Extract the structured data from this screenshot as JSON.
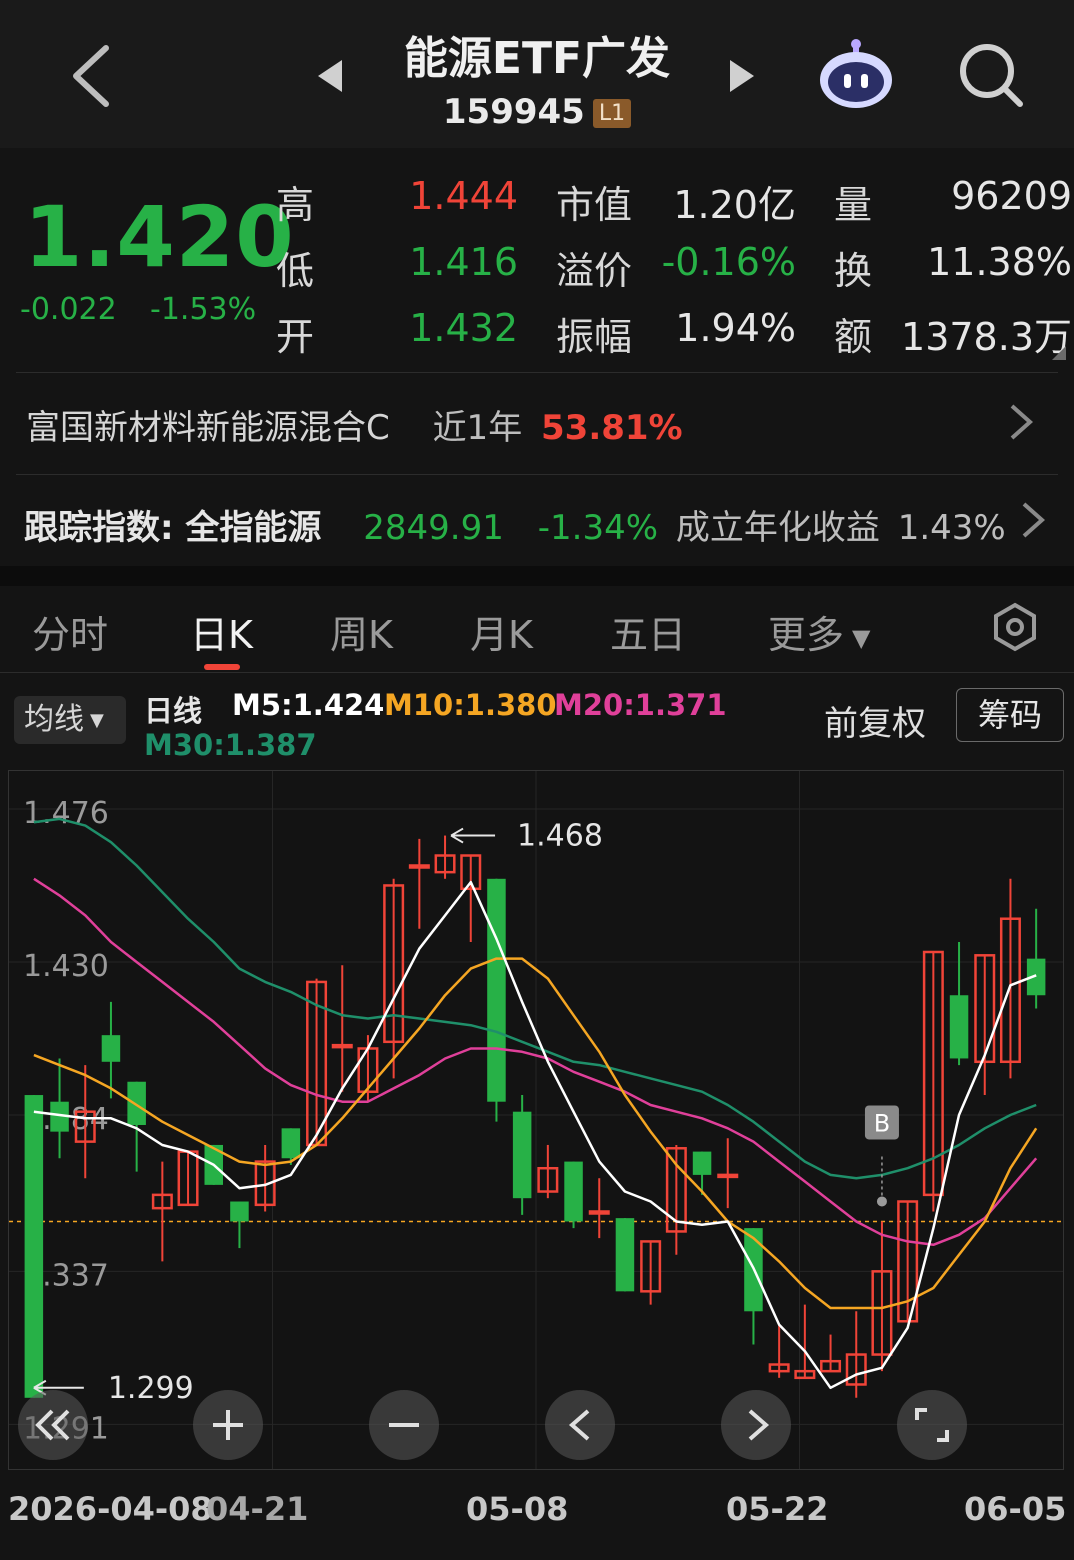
{
  "header": {
    "title": "能源ETF广发",
    "code": "159945",
    "level_badge": "L1"
  },
  "quote": {
    "price": "1.420",
    "change": "-0.022",
    "change_pct": "-1.53%",
    "labels": {
      "high": "高",
      "low": "低",
      "open": "开",
      "mktcap": "市值",
      "premium": "溢价",
      "amplitude": "振幅",
      "volume": "量",
      "turnover": "换",
      "amount": "额"
    },
    "high": "1.444",
    "low": "1.416",
    "open": "1.432",
    "mktcap": "1.20亿",
    "premium": "-0.16%",
    "amplitude": "1.94%",
    "volume": "96209",
    "turnover": "11.38%",
    "amount": "1378.3万"
  },
  "fund_row": {
    "name": "富国新材料新能源混合C",
    "period": "近1年",
    "return": "53.81%"
  },
  "index_row": {
    "label": "跟踪指数: 全指能源",
    "value": "2849.91",
    "change": "-1.34%",
    "since_label": "成立年化收益",
    "since_value": "1.43%"
  },
  "tabs": [
    "分时",
    "日K",
    "周K",
    "月K",
    "五日",
    "更多"
  ],
  "active_tab": "日K",
  "ma_toolbar": {
    "ma_button": "均线",
    "period": "日线",
    "m5": "M5:1.424",
    "m10": "M10:1.380",
    "m20": "M20:1.371",
    "m30": "M30:1.387",
    "adjust": "前复权",
    "chip": "筹码"
  },
  "colors": {
    "up": "#f04438",
    "down": "#27b147",
    "m5": "#ffffff",
    "m10": "#f5a623",
    "m20": "#e0409a",
    "m30": "#1f8f6a",
    "bg": "#141414"
  },
  "chart_data": {
    "type": "candlestick",
    "y_ticks": [
      "1.476",
      "1.430",
      "1.384",
      "1.337",
      "1.291"
    ],
    "ylim": [
      1.28,
      1.485
    ],
    "x_tick_labels": [
      "2026-04-08",
      "04-21",
      "05-08",
      "05-22",
      "06-05"
    ],
    "max_annotation": "1.468",
    "min_annotation": "1.299",
    "signal_marker": "B",
    "ref_price": 1.352,
    "candles": [
      {
        "o": 1.39,
        "h": 1.39,
        "l": 1.299,
        "c": 1.299
      },
      {
        "o": 1.388,
        "h": 1.401,
        "l": 1.371,
        "c": 1.379
      },
      {
        "o": 1.376,
        "h": 1.399,
        "l": 1.365,
        "c": 1.385
      },
      {
        "o": 1.408,
        "h": 1.418,
        "l": 1.389,
        "c": 1.4
      },
      {
        "o": 1.394,
        "h": 1.394,
        "l": 1.367,
        "c": 1.381
      },
      {
        "o": 1.356,
        "h": 1.37,
        "l": 1.34,
        "c": 1.36
      },
      {
        "o": 1.357,
        "h": 1.373,
        "l": 1.357,
        "c": 1.373
      },
      {
        "o": 1.375,
        "h": 1.375,
        "l": 1.363,
        "c": 1.363
      },
      {
        "o": 1.358,
        "h": 1.358,
        "l": 1.344,
        "c": 1.352
      },
      {
        "o": 1.357,
        "h": 1.375,
        "l": 1.355,
        "c": 1.37
      },
      {
        "o": 1.38,
        "h": 1.38,
        "l": 1.369,
        "c": 1.371
      },
      {
        "o": 1.375,
        "h": 1.425,
        "l": 1.375,
        "c": 1.424
      },
      {
        "o": 1.405,
        "h": 1.429,
        "l": 1.391,
        "c": 1.405
      },
      {
        "o": 1.391,
        "h": 1.408,
        "l": 1.388,
        "c": 1.404
      },
      {
        "o": 1.406,
        "h": 1.455,
        "l": 1.395,
        "c": 1.453
      },
      {
        "o": 1.459,
        "h": 1.467,
        "l": 1.44,
        "c": 1.459
      },
      {
        "o": 1.457,
        "h": 1.468,
        "l": 1.455,
        "c": 1.462
      },
      {
        "o": 1.452,
        "h": 1.462,
        "l": 1.436,
        "c": 1.462
      },
      {
        "o": 1.455,
        "h": 1.455,
        "l": 1.382,
        "c": 1.388
      },
      {
        "o": 1.385,
        "h": 1.39,
        "l": 1.354,
        "c": 1.359
      },
      {
        "o": 1.361,
        "h": 1.375,
        "l": 1.359,
        "c": 1.368
      },
      {
        "o": 1.37,
        "h": 1.37,
        "l": 1.35,
        "c": 1.352
      },
      {
        "o": 1.355,
        "h": 1.365,
        "l": 1.347,
        "c": 1.355
      },
      {
        "o": 1.353,
        "h": 1.353,
        "l": 1.331,
        "c": 1.331
      },
      {
        "o": 1.331,
        "h": 1.346,
        "l": 1.327,
        "c": 1.346
      },
      {
        "o": 1.349,
        "h": 1.375,
        "l": 1.342,
        "c": 1.374
      },
      {
        "o": 1.373,
        "h": 1.373,
        "l": 1.36,
        "c": 1.366
      },
      {
        "o": 1.366,
        "h": 1.377,
        "l": 1.356,
        "c": 1.366
      },
      {
        "o": 1.35,
        "h": 1.35,
        "l": 1.315,
        "c": 1.325
      },
      {
        "o": 1.307,
        "h": 1.321,
        "l": 1.305,
        "c": 1.309
      },
      {
        "o": 1.305,
        "h": 1.327,
        "l": 1.305,
        "c": 1.307
      },
      {
        "o": 1.307,
        "h": 1.318,
        "l": 1.307,
        "c": 1.31
      },
      {
        "o": 1.303,
        "h": 1.325,
        "l": 1.299,
        "c": 1.312
      },
      {
        "o": 1.312,
        "h": 1.352,
        "l": 1.307,
        "c": 1.337
      },
      {
        "o": 1.322,
        "h": 1.358,
        "l": 1.322,
        "c": 1.358
      },
      {
        "o": 1.36,
        "h": 1.433,
        "l": 1.355,
        "c": 1.433
      },
      {
        "o": 1.42,
        "h": 1.436,
        "l": 1.399,
        "c": 1.401
      },
      {
        "o": 1.4,
        "h": 1.432,
        "l": 1.39,
        "c": 1.432
      },
      {
        "o": 1.4,
        "h": 1.455,
        "l": 1.395,
        "c": 1.443
      },
      {
        "o": 1.431,
        "h": 1.446,
        "l": 1.416,
        "c": 1.42
      }
    ],
    "m5": [
      1.385,
      1.384,
      1.383,
      1.383,
      1.38,
      1.375,
      1.373,
      1.369,
      1.362,
      1.363,
      1.366,
      1.378,
      1.392,
      1.404,
      1.419,
      1.434,
      1.444,
      1.454,
      1.437,
      1.418,
      1.4,
      1.385,
      1.37,
      1.361,
      1.358,
      1.352,
      1.351,
      1.352,
      1.338,
      1.321,
      1.313,
      1.302,
      1.306,
      1.308,
      1.32,
      1.35,
      1.384,
      1.402,
      1.423,
      1.426
    ],
    "m10": [
      1.402,
      1.399,
      1.396,
      1.392,
      1.387,
      1.382,
      1.378,
      1.374,
      1.37,
      1.369,
      1.37,
      1.375,
      1.383,
      1.392,
      1.401,
      1.41,
      1.42,
      1.428,
      1.431,
      1.431,
      1.425,
      1.414,
      1.403,
      1.39,
      1.379,
      1.369,
      1.361,
      1.352,
      1.347,
      1.34,
      1.332,
      1.326,
      1.326,
      1.326,
      1.328,
      1.332,
      1.342,
      1.352,
      1.368,
      1.38
    ],
    "m20": [
      1.455,
      1.45,
      1.444,
      1.436,
      1.43,
      1.424,
      1.418,
      1.412,
      1.405,
      1.398,
      1.393,
      1.39,
      1.388,
      1.388,
      1.392,
      1.396,
      1.401,
      1.404,
      1.404,
      1.403,
      1.401,
      1.397,
      1.394,
      1.391,
      1.387,
      1.385,
      1.383,
      1.38,
      1.376,
      1.37,
      1.364,
      1.358,
      1.352,
      1.348,
      1.346,
      1.345,
      1.348,
      1.353,
      1.362,
      1.371
    ],
    "m30": [
      1.472,
      1.473,
      1.471,
      1.466,
      1.459,
      1.451,
      1.443,
      1.436,
      1.428,
      1.424,
      1.421,
      1.417,
      1.414,
      1.413,
      1.414,
      1.413,
      1.412,
      1.411,
      1.409,
      1.406,
      1.403,
      1.4,
      1.399,
      1.397,
      1.395,
      1.393,
      1.391,
      1.387,
      1.382,
      1.376,
      1.37,
      1.366,
      1.365,
      1.366,
      1.368,
      1.371,
      1.375,
      1.38,
      1.384,
      1.387
    ]
  }
}
